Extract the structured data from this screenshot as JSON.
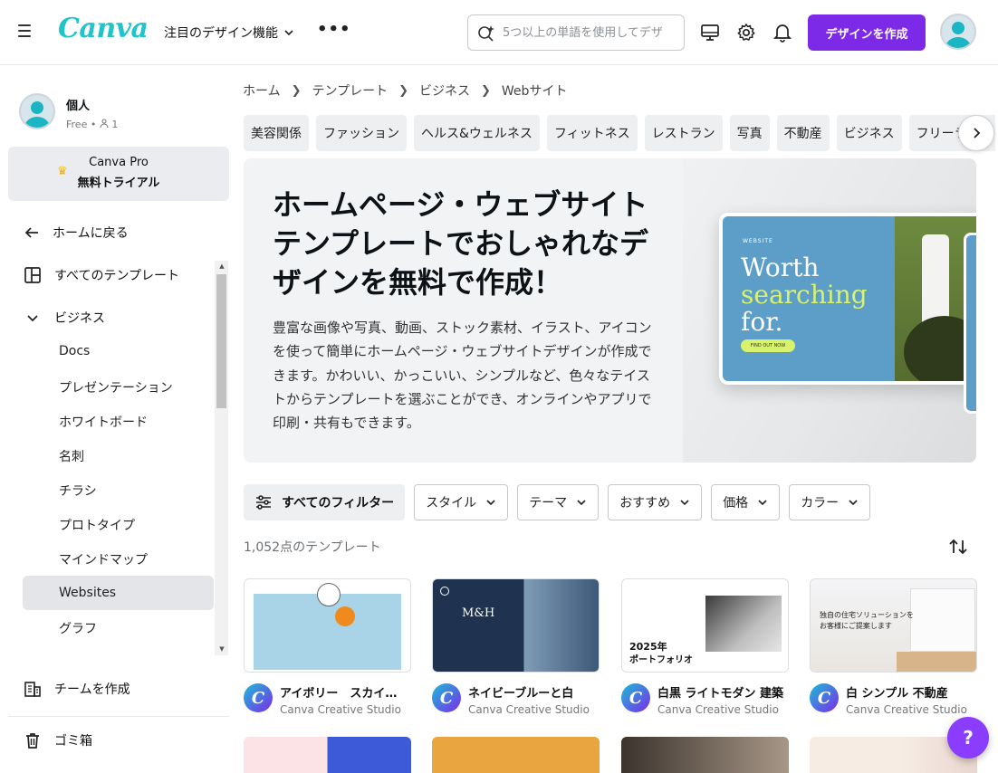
{
  "header": {
    "logo": "Canva",
    "feature_menu": "注目のデザイン機能",
    "more": "•••",
    "search_placeholder": "5つ以上の単語を使用してデザ",
    "create_button": "デザインを作成"
  },
  "sidebar": {
    "profile_name": "個人",
    "profile_plan": "Free",
    "profile_members": "1",
    "pro_line1": "Canva Pro",
    "pro_line2": "無料トライアル",
    "back_home": "ホームに戻る",
    "all_templates": "すべてのテンプレート",
    "business": "ビジネス",
    "sub_items": [
      "Docs",
      "プレゼンテーション",
      "ホワイトボード",
      "名刺",
      "チラシ",
      "プロトタイプ",
      "マインドマップ",
      "Websites",
      "グラフ"
    ],
    "active_sub": "Websites",
    "create_team": "チームを作成",
    "trash": "ゴミ箱"
  },
  "breadcrumb": [
    "ホーム",
    "テンプレート",
    "ビジネス",
    "Webサイト"
  ],
  "chips": [
    "美容関係",
    "ファッション",
    "ヘルス&ウェルネス",
    "フィットネス",
    "レストラン",
    "写真",
    "不動産",
    "ビジネス",
    "フリーランス"
  ],
  "hero": {
    "title": "ホームページ・ウェブサイトテンプレートでおしゃれなデザインを無料で作成！",
    "description": "豊富な画像や写真、動画、ストック素材、イラスト、アイコンを使って簡単にホームページ・ウェブサイトデザインが作成できます。かわいい、かっこいい、シンプルなど、色々なテイストからテンプレートを選ぶことができ、オンラインやアプリで印刷・共有もできます。",
    "mockup_small": "WEBSITE",
    "mockup_line1": "Worth",
    "mockup_line2": "searching",
    "mockup_line3": "for.",
    "mockup_button": "FIND OUT NOW"
  },
  "filters": {
    "all": "すべてのフィルター",
    "dropdowns": [
      "スタイル",
      "テーマ",
      "おすすめ",
      "価格",
      "カラー"
    ]
  },
  "result_count": "1,052点のテンプレート",
  "templates": [
    {
      "title": "アイボリー　スカイブルー",
      "author": "Canva Creative Studio"
    },
    {
      "title": "ネイビーブルーと白",
      "author": "Canva Creative Studio"
    },
    {
      "title": "白黒 ライトモダン 建築",
      "author": "Canva Creative Studio"
    },
    {
      "title": "白 シンプル 不動産",
      "author": "Canva Creative Studio"
    }
  ],
  "thumb_text": {
    "t2_brand": "M&H",
    "t3_year": "2025年",
    "t3_caption": "ポートフォリオ",
    "t4_line1": "独自の住宅ソリューションを",
    "t4_line2": "お客様にご提案します"
  },
  "help": "?"
}
